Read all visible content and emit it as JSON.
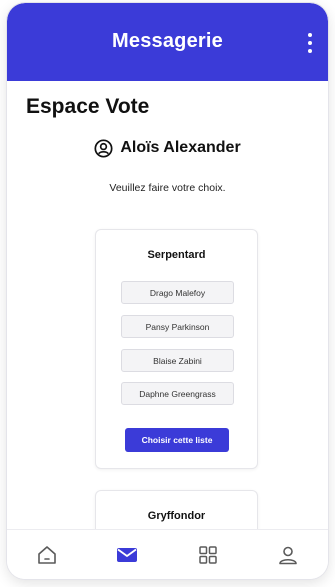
{
  "header": {
    "title": "Messagerie",
    "menu_icon": "more-vertical-icon"
  },
  "page": {
    "title": "Espace Vote",
    "user_icon": "user-circle-icon",
    "user_name": "Aloïs Alexander",
    "prompt": "Veuillez faire votre choix."
  },
  "lists": [
    {
      "name": "Serpentard",
      "candidates": [
        "Drago Malefoy",
        "Pansy Parkinson",
        "Blaise Zabini",
        "Daphne Greengrass"
      ],
      "button_label": "Choisir cette liste"
    },
    {
      "name": "Gryffondor"
    }
  ],
  "bottom_nav": {
    "items": [
      {
        "icon": "home-icon",
        "active": false
      },
      {
        "icon": "mail-icon",
        "active": true
      },
      {
        "icon": "grid-icon",
        "active": false
      },
      {
        "icon": "user-icon",
        "active": false
      }
    ]
  },
  "colors": {
    "primary": "#3b3bd8",
    "icon_inactive": "#5a5a5a"
  }
}
